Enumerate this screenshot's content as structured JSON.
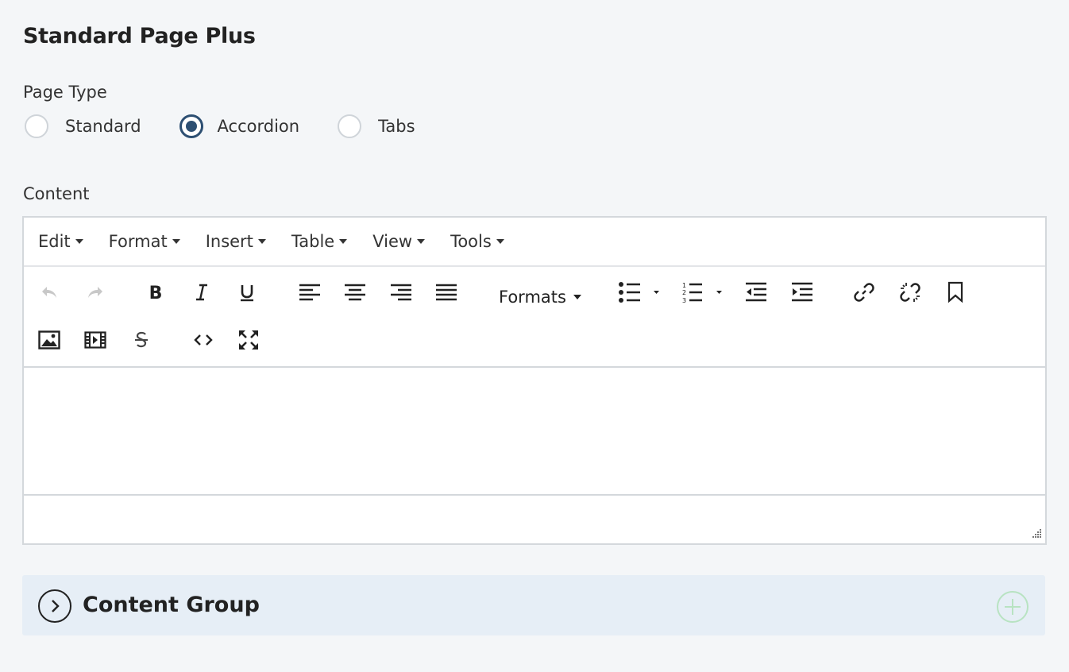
{
  "page": {
    "title": "Standard Page Plus"
  },
  "page_type": {
    "label": "Page Type",
    "options": [
      {
        "label": "Standard",
        "selected": false
      },
      {
        "label": "Accordion",
        "selected": true
      },
      {
        "label": "Tabs",
        "selected": false
      }
    ]
  },
  "content": {
    "label": "Content",
    "menubar": [
      "Edit",
      "Format",
      "Insert",
      "Table",
      "View",
      "Tools"
    ],
    "toolbar": {
      "formats_label": "Formats",
      "icons": [
        "undo-icon",
        "redo-icon",
        "bold-icon",
        "italic-icon",
        "underline-icon",
        "align-left-icon",
        "align-center-icon",
        "align-right-icon",
        "align-justify-icon",
        "bullet-list-icon",
        "numbered-list-icon",
        "outdent-icon",
        "indent-icon",
        "link-icon",
        "unlink-icon",
        "bookmark-icon",
        "image-icon",
        "media-icon",
        "strikethrough-icon",
        "code-icon",
        "fullscreen-icon"
      ]
    },
    "body_text": ""
  },
  "content_group": {
    "title": "Content Group"
  },
  "colors": {
    "background": "#f4f6f8",
    "radio_selected": "#2d4f72",
    "group_background": "#e6eef6",
    "add_accent": "#b8e3c2"
  }
}
